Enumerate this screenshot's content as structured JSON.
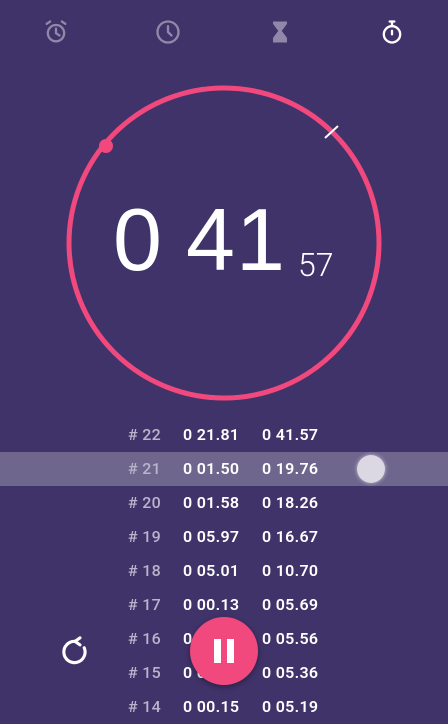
{
  "tabs": [
    {
      "icon": "alarm-icon",
      "active": false
    },
    {
      "icon": "clock-icon",
      "active": false
    },
    {
      "icon": "timer-hourglass-icon",
      "active": false
    },
    {
      "icon": "stopwatch-icon",
      "active": true
    }
  ],
  "stopwatch": {
    "minutes": "0",
    "seconds": "41",
    "hundredths": "57"
  },
  "laps": [
    {
      "num": "# 22",
      "lap": "0 21.81",
      "total": "0 41.57"
    },
    {
      "num": "# 21",
      "lap": "0 01.50",
      "total": "0 19.76",
      "highlight": true
    },
    {
      "num": "# 20",
      "lap": "0 01.58",
      "total": "0 18.26"
    },
    {
      "num": "# 19",
      "lap": "0 05.97",
      "total": "0 16.67"
    },
    {
      "num": "# 18",
      "lap": "0 05.01",
      "total": "0 10.70"
    },
    {
      "num": "# 17",
      "lap": "0 00.13",
      "total": "0 05.69"
    },
    {
      "num": "# 16",
      "lap": "0 00.13",
      "total": "0 05.56"
    },
    {
      "num": "# 15",
      "lap": "0 00.17",
      "total": "0 05.36"
    },
    {
      "num": "# 14",
      "lap": "0 00.15",
      "total": "0 05.19"
    }
  ],
  "colors": {
    "background": "#3f3369",
    "accent": "#f1487e"
  },
  "controls": {
    "reset_icon": "reset-icon",
    "pause_icon": "pause-icon"
  }
}
